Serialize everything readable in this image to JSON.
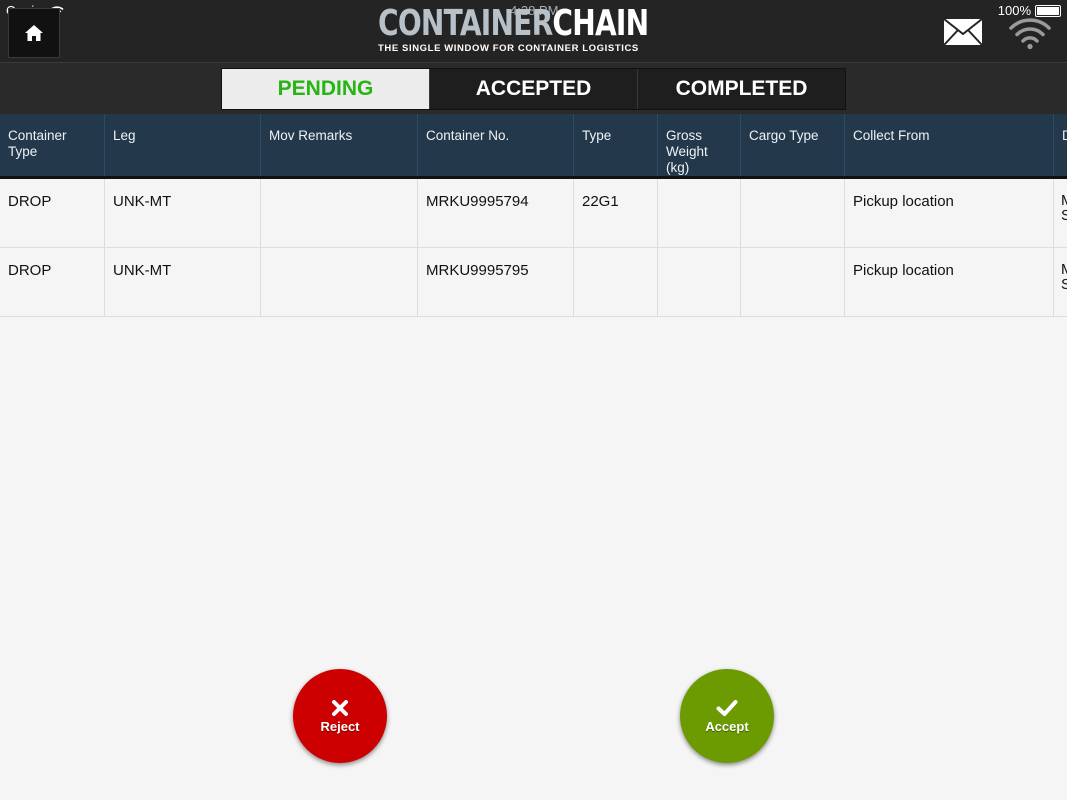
{
  "status_bar": {
    "carrier": "Carrier",
    "time": "4:28 PM",
    "battery": "100%"
  },
  "app": {
    "logo_part1": "CONTAINER",
    "logo_part2": "CHAIN",
    "tagline": "THE SINGLE WINDOW FOR CONTAINER LOGISTICS"
  },
  "tabs": [
    {
      "label": "PENDING",
      "active": true
    },
    {
      "label": "ACCEPTED",
      "active": false
    },
    {
      "label": "COMPLETED",
      "active": false
    }
  ],
  "table": {
    "headers": [
      "Container\nType",
      "Leg",
      "Mov Remarks",
      "Container No.",
      "Type",
      "Gross\nWeight (kg)",
      "Cargo Type",
      "Collect From",
      "D"
    ],
    "rows": [
      [
        "DROP",
        "UNK-MT",
        "",
        "MRKU9995794",
        "22G1",
        "",
        "",
        "Pickup location",
        "M\nS"
      ],
      [
        "DROP",
        "UNK-MT",
        "",
        "MRKU9995795",
        "",
        "",
        "",
        "Pickup location",
        "M\nS"
      ]
    ]
  },
  "actions": {
    "reject_label": "Reject",
    "accept_label": "Accept"
  },
  "colors": {
    "header_bg": "#23394b",
    "active_tab_text": "#27b513",
    "reject": "#cc0000",
    "accept": "#6b9b00"
  },
  "icons": [
    "home-icon",
    "mail-icon",
    "wifi-icon",
    "close-icon",
    "check-icon",
    "battery-icon"
  ]
}
